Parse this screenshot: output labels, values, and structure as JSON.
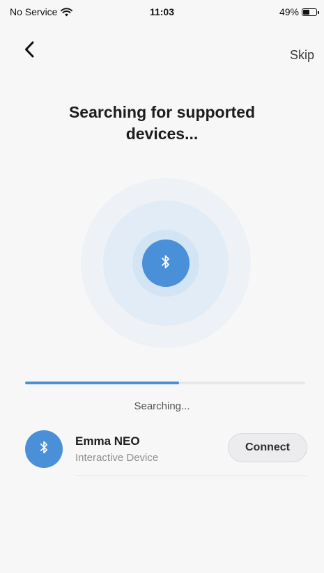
{
  "status_bar": {
    "carrier": "No Service",
    "time": "11:03",
    "battery_percent": "49%",
    "battery_level": 0.49,
    "wifi_icon": "wifi-icon",
    "battery_icon": "battery-icon"
  },
  "nav": {
    "back_icon": "chevron-left-icon",
    "skip_label": "Skip"
  },
  "title": "Searching for supported devices...",
  "scanner": {
    "icon": "bluetooth-icon",
    "progress": 0.55,
    "status_text": "Searching..."
  },
  "devices": [
    {
      "name": "Emma NEO",
      "type": "Interactive Device",
      "icon": "bluetooth-icon",
      "action_label": "Connect"
    }
  ],
  "colors": {
    "accent": "#4a90d9",
    "background": "#f7f7f7",
    "button_bg": "#ececee"
  }
}
